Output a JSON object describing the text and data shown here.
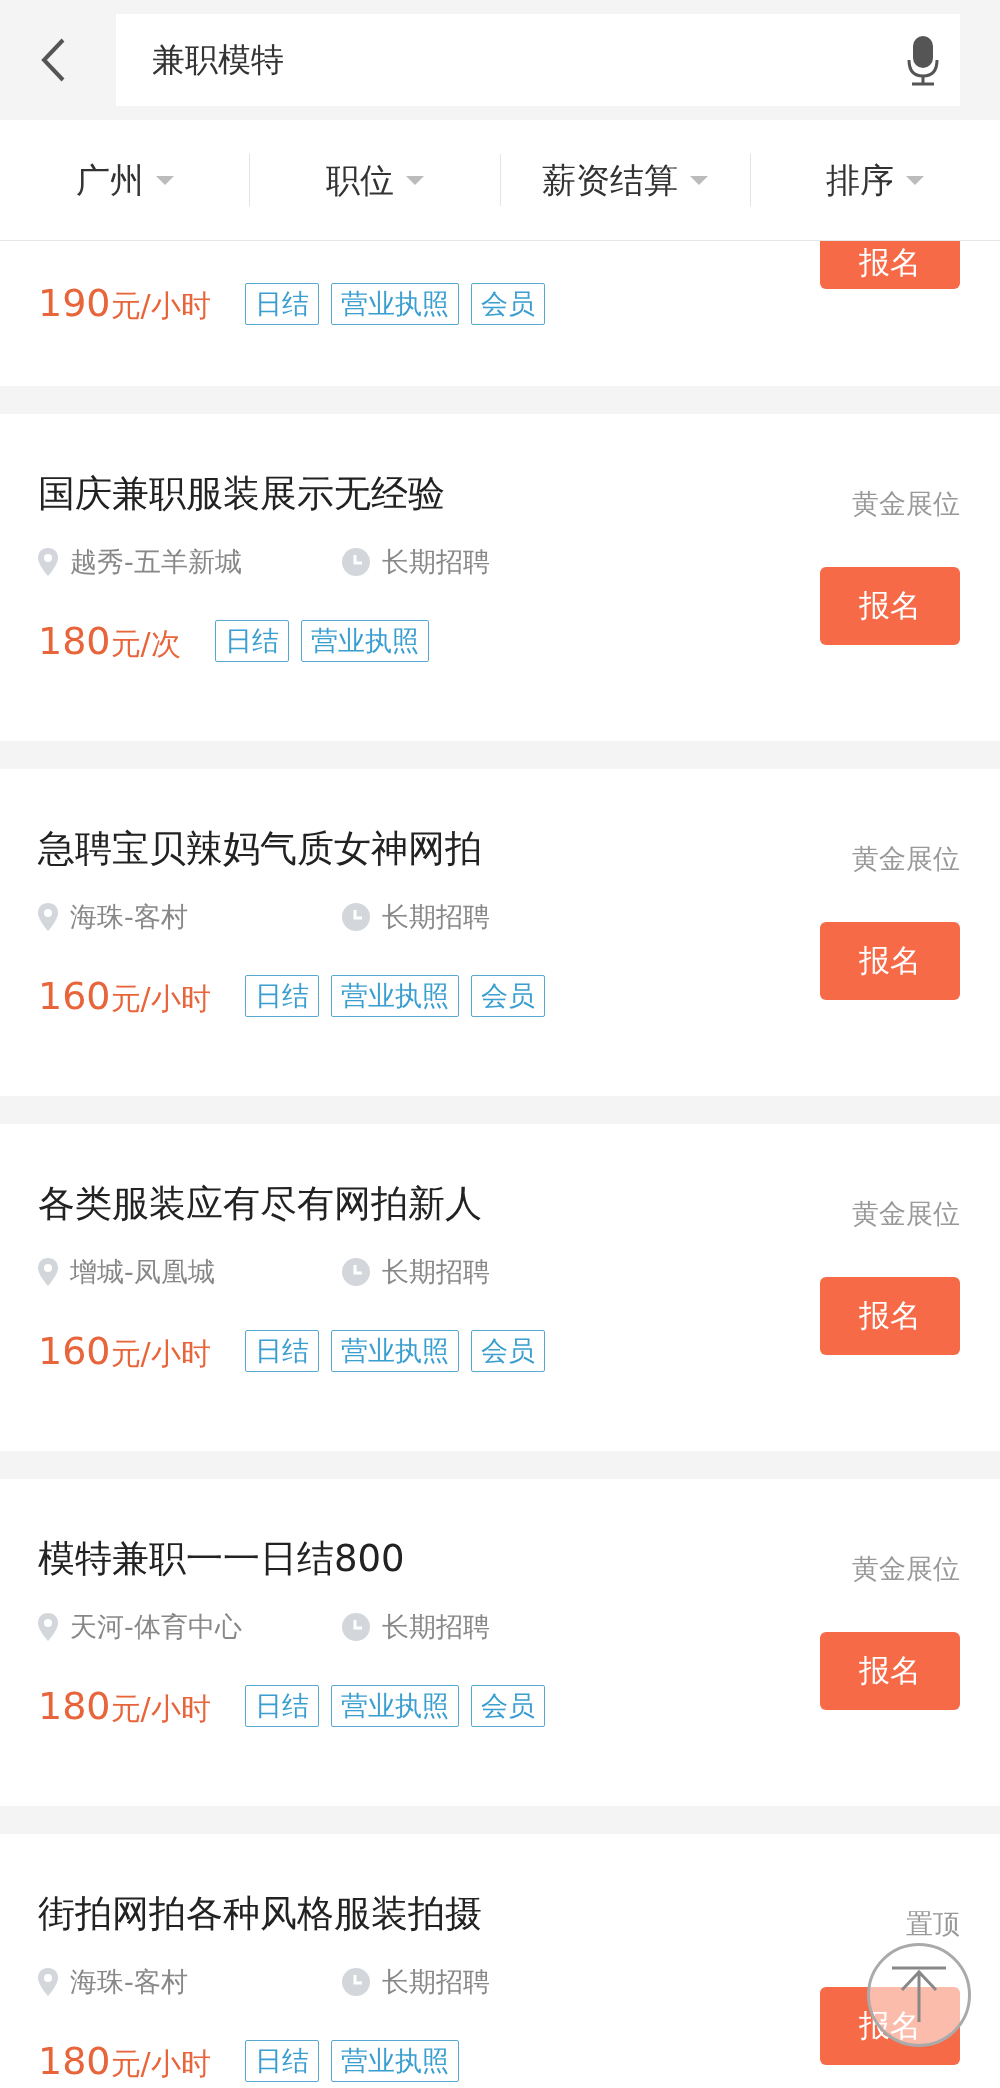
{
  "search": {
    "value": "兼职模特"
  },
  "filters": [
    {
      "label": "广州"
    },
    {
      "label": "职位"
    },
    {
      "label": "薪资结算"
    },
    {
      "label": "排序"
    }
  ],
  "jobs": [
    {
      "partial": true,
      "price": "190",
      "unit": "元/小时",
      "tags": [
        "日结",
        "营业执照",
        "会员"
      ],
      "button": "报名"
    },
    {
      "title": "国庆兼职服装展示无经验",
      "badge": "黄金展位",
      "location": "越秀-五羊新城",
      "period": "长期招聘",
      "price": "180",
      "unit": "元/次",
      "tags": [
        "日结",
        "营业执照"
      ],
      "button": "报名"
    },
    {
      "title": "急聘宝贝辣妈气质女神网拍",
      "badge": "黄金展位",
      "location": "海珠-客村",
      "period": "长期招聘",
      "price": "160",
      "unit": "元/小时",
      "tags": [
        "日结",
        "营业执照",
        "会员"
      ],
      "button": "报名"
    },
    {
      "title": "各类服装应有尽有网拍新人",
      "badge": "黄金展位",
      "location": "增城-凤凰城",
      "period": "长期招聘",
      "price": "160",
      "unit": "元/小时",
      "tags": [
        "日结",
        "营业执照",
        "会员"
      ],
      "button": "报名"
    },
    {
      "title": "模特兼职一一日结800",
      "badge": "黄金展位",
      "location": "天河-体育中心",
      "period": "长期招聘",
      "price": "180",
      "unit": "元/小时",
      "tags": [
        "日结",
        "营业执照",
        "会员"
      ],
      "button": "报名"
    },
    {
      "title": "街拍网拍各种风格服装拍摄",
      "badge": "置顶",
      "location": "海珠-客村",
      "period": "长期招聘",
      "price": "180",
      "unit": "元/小时",
      "tags": [
        "日结",
        "营业执照"
      ],
      "button": "报名"
    }
  ]
}
